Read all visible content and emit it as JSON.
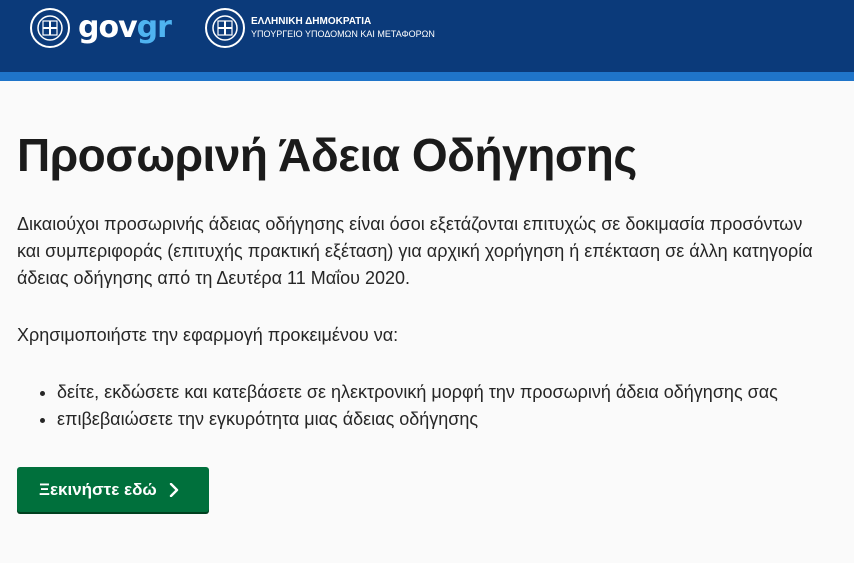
{
  "header": {
    "logo_primary": "gov",
    "logo_accent": "gr",
    "ministry_line1": "ΕΛΛΗΝΙΚΗ ΔΗΜΟΚΡΑΤΙΑ",
    "ministry_line2": "ΥΠΟΥΡΓΕΙΟ ΥΠΟΔΟΜΩΝ ΚΑΙ ΜΕΤΑΦΟΡΩΝ",
    "colors": {
      "bar": "#0b3a7a",
      "strip": "#1f74c9",
      "accent": "#4fb3f0"
    }
  },
  "main": {
    "title": "Προσωρινή Άδεια Οδήγησης",
    "intro": "Δικαιούχοι προσωρινής άδειας οδήγησης είναι όσοι εξετάζονται επιτυχώς σε δοκιμασία προσόντων και συμπεριφοράς (επιτυχής πρακτική εξέταση) για αρχική χορήγηση ή επέκταση σε άλλη κατηγορία άδειας οδήγησης από τη Δευτέρα 11 Μαΐου 2020.",
    "use_line": "Χρησιμοποιήστε την εφαρμογή προκειμένου να:",
    "bullets": [
      "δείτε, εκδώσετε και κατεβάσετε σε ηλεκτρονική μορφή την προσωρινή άδεια οδήγησης σας",
      "επιβεβαιώσετε την εγκυρότητα μιας άδειας οδήγησης"
    ],
    "start_button": "Ξεκινήστε εδώ",
    "button_color": "#00703c",
    "icons": {
      "emblem": "greek-emblem-icon",
      "chevron": "chevron-right-icon"
    }
  }
}
